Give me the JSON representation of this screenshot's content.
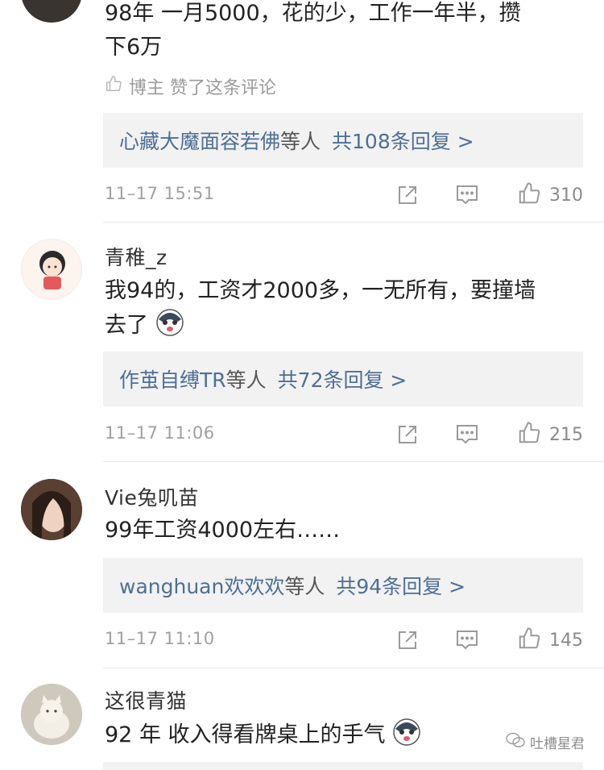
{
  "comments": [
    {
      "username": "",
      "text_line1": "98年 一月5000，花的少，工作一年半，攒",
      "text_line2": "下6万",
      "author_liked": "博主 赞了这条评论",
      "reply_names": "心藏大魔面容若佛",
      "reply_suffix": "等人",
      "reply_count": "共108条回复 >",
      "time": "11–17 15:51",
      "likes": "310"
    },
    {
      "username": "青稚_z",
      "text_line1": "我94的，工资才2000多，一无所有，要撞墙",
      "text_line2": "去了",
      "reply_names": "作茧自缚TR",
      "reply_suffix": "等人",
      "reply_count": "共72条回复 >",
      "time": "11–17 11:06",
      "likes": "215"
    },
    {
      "username": "Vie兔叽苗",
      "text_line1": "99年工资4000左右……",
      "reply_names": "wanghuan欢欢欢",
      "reply_suffix": "等人",
      "reply_count": "共94条回复 >",
      "time": "11–17 11:10",
      "likes": "145"
    },
    {
      "username": "这很青猫",
      "text_line1": "92 年 收入得看牌桌上的手气"
    }
  ],
  "watermark": "吐槽星君",
  "icons": {
    "share": "share-icon",
    "comment": "comment-icon",
    "like": "thumbs-up-icon",
    "emoji": "husky-emoji-icon"
  },
  "colors": {
    "link": "#4e6f96",
    "meta": "#a0a0a0",
    "reply_bg": "#f2f2f2"
  }
}
